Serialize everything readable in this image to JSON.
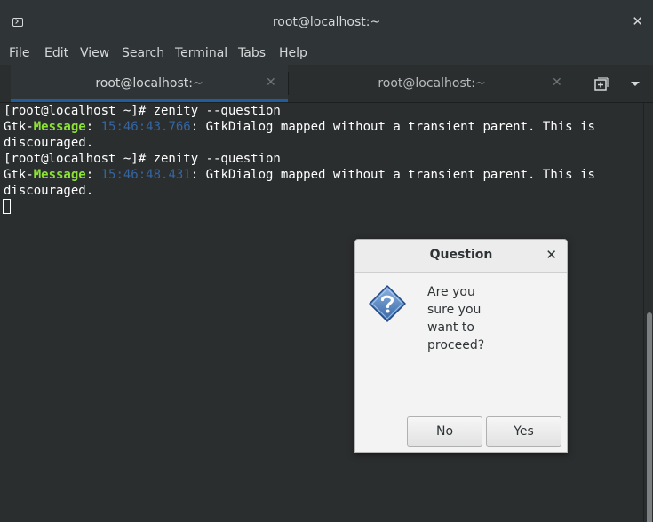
{
  "window": {
    "title": "root@localhost:~",
    "close_glyph": "✕"
  },
  "menu": {
    "items": [
      "File",
      "Edit",
      "View",
      "Search",
      "Terminal",
      "Tabs",
      "Help"
    ]
  },
  "tabs": [
    {
      "label": "root@localhost:~",
      "close_glyph": "✕",
      "active": true
    },
    {
      "label": "root@localhost:~",
      "close_glyph": "✕",
      "active": false
    }
  ],
  "terminal": {
    "lines": [
      {
        "prompt": "[root@localhost ~]# zenity --question"
      },
      {
        "prefix": "Gtk-",
        "keyword": "Message",
        "sep": ": ",
        "time": "15:46:43.766",
        "rest": ": GtkDialog mapped without a transient parent. This is"
      },
      {
        "text": "discouraged."
      },
      {
        "prompt": "[root@localhost ~]# zenity --question"
      },
      {
        "prefix": "Gtk-",
        "keyword": "Message",
        "sep": ": ",
        "time": "15:46:48.431",
        "rest": ": GtkDialog mapped without a transient parent. This is"
      },
      {
        "text": "discouraged."
      }
    ]
  },
  "dialog": {
    "title": "Question",
    "close_glyph": "✕",
    "message_lines": [
      "Are you",
      "sure you",
      "want to",
      "proceed?"
    ],
    "buttons": {
      "no": "No",
      "yes": "Yes"
    },
    "icon": "question-icon"
  },
  "colors": {
    "terminal_bg": "#2b2e2f",
    "keyword_green": "#8ae234",
    "timestamp_blue": "#3465a4",
    "active_tab_underline": "#215d9c"
  }
}
